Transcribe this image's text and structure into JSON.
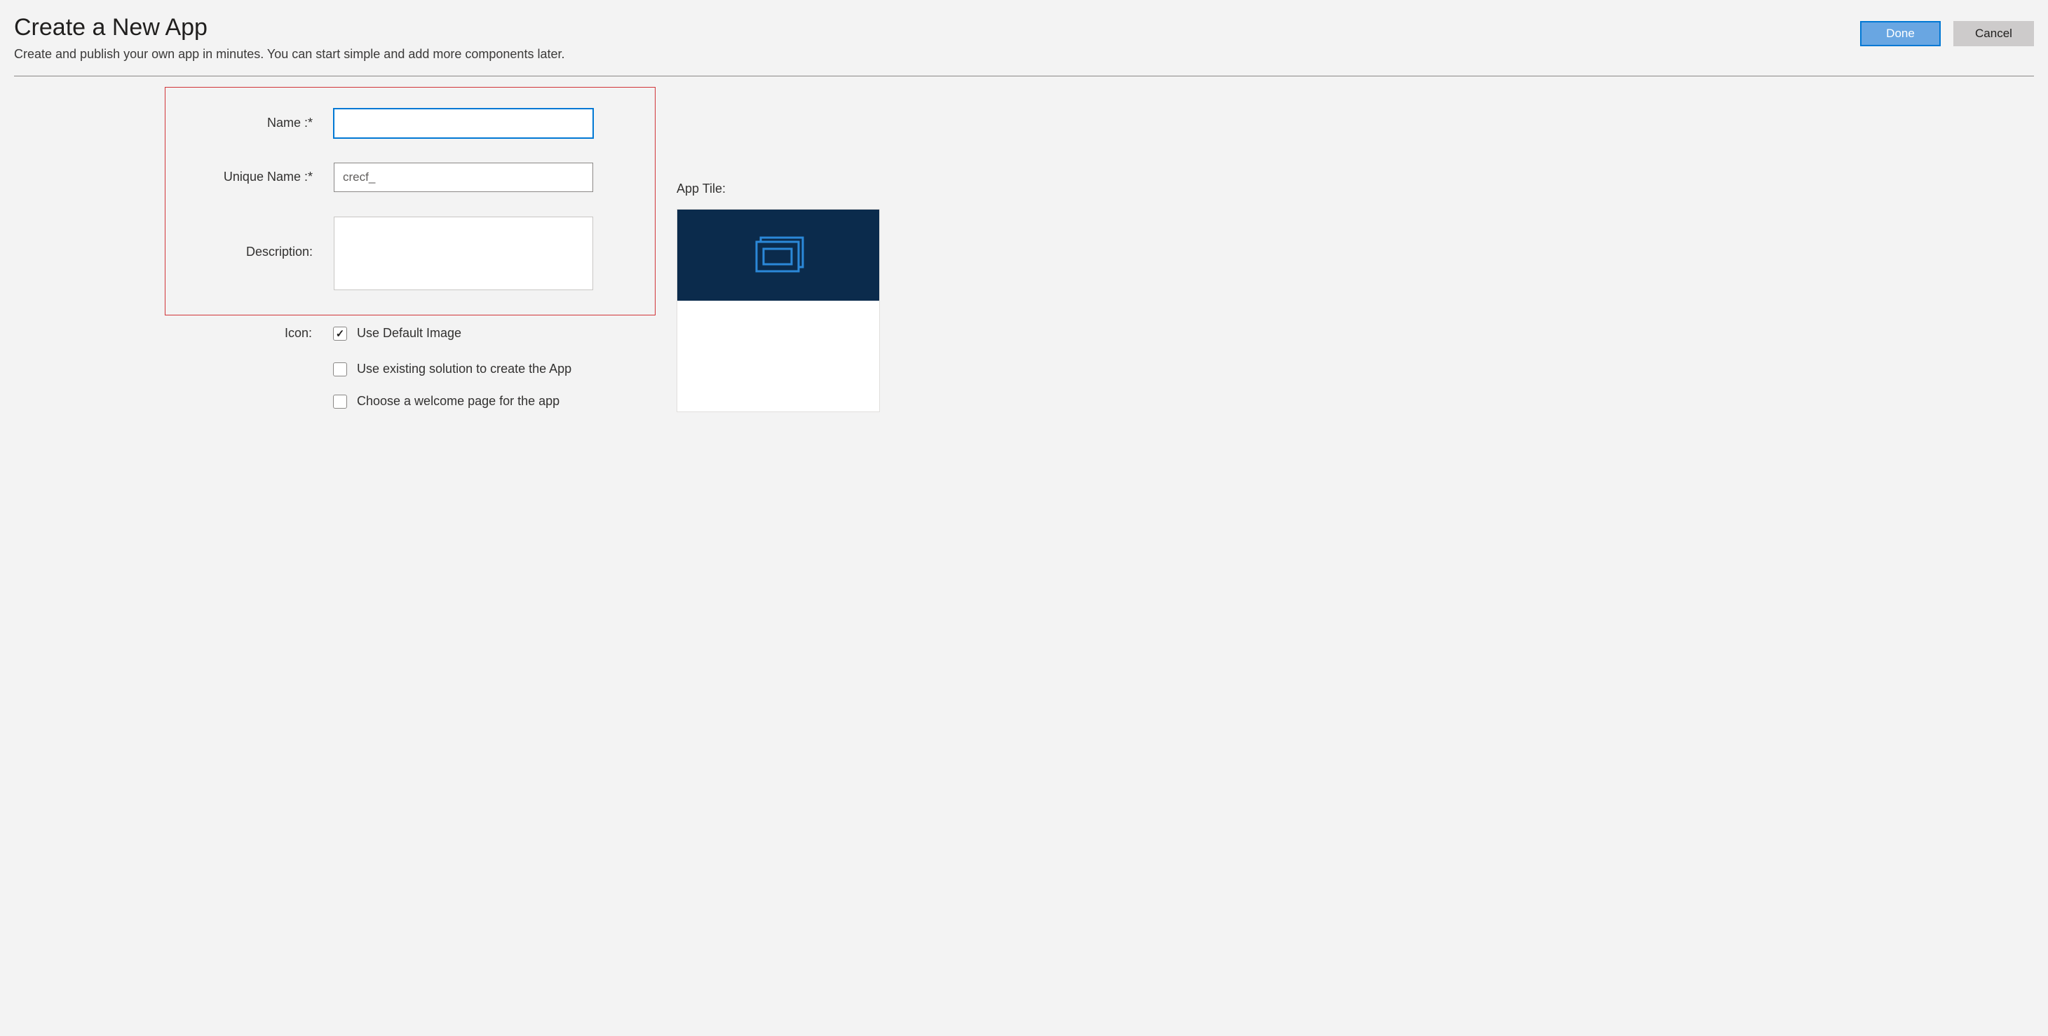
{
  "header": {
    "title": "Create a New App",
    "subtitle": "Create and publish your own app in minutes. You can start simple and add more components later.",
    "done_label": "Done",
    "cancel_label": "Cancel"
  },
  "form": {
    "name_label": "Name :*",
    "name_value": "",
    "unique_name_label": "Unique Name :*",
    "unique_name_value": "crecf_",
    "description_label": "Description:",
    "description_value": "",
    "icon_label": "Icon:",
    "use_default_image_label": "Use Default Image",
    "use_default_image_checked": true,
    "use_existing_solution_label": "Use existing solution to create the App",
    "use_existing_solution_checked": false,
    "choose_welcome_page_label": "Choose a welcome page for the app",
    "choose_welcome_page_checked": false
  },
  "app_tile": {
    "label": "App Tile:"
  }
}
